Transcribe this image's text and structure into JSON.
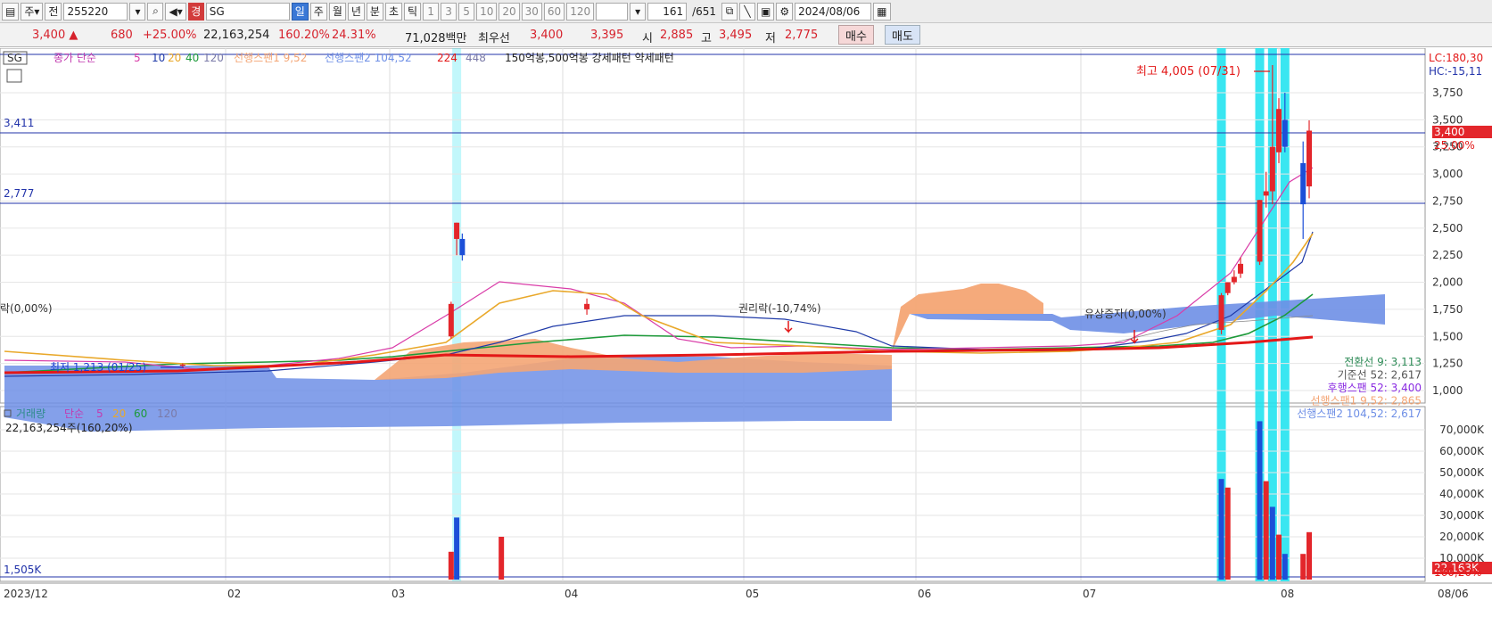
{
  "toolbar": {
    "market_prefix": "주",
    "prev_label": "전",
    "code": "255220",
    "badge": "경",
    "name": "SG",
    "periods": [
      "일",
      "주",
      "월",
      "년",
      "분",
      "초",
      "틱"
    ],
    "intervals": [
      "1",
      "3",
      "5",
      "10",
      "20",
      "30",
      "60",
      "120"
    ],
    "count": "161",
    "total": "/651",
    "date": "2024/08/06"
  },
  "quote": {
    "price": "3,400 ▲",
    "change": "680",
    "change_pct": "+25.00%",
    "volume": "22,163,254",
    "volume_pct": "160.20%",
    "turnover": "24.31%",
    "amount": "71,028백만",
    "bid_label": "최우선",
    "ask": "3,400",
    "bid": "3,395",
    "open_label": "시",
    "open": "2,885",
    "high_label": "고",
    "high": "3,495",
    "low_label": "저",
    "low": "2,775",
    "buy_label": "매수",
    "sell_label": "매도"
  },
  "colors": {
    "up": "#e3262b",
    "down": "#1c4fd8",
    "highlight": "#24e3f0",
    "cloud_pos": "#f4a574",
    "cloud_neg": "#6e8fe6",
    "ma5": "#d93ca8",
    "ma10": "#1f3aa8",
    "ma20": "#e9a82a",
    "ma40": "#1d9a3a",
    "ma120": "#e31818"
  },
  "price_legend": {
    "marker": "SG",
    "ma_title": "종가 단순",
    "ma_periods": [
      "5",
      "10",
      "20",
      "40",
      "120"
    ],
    "span1": "선행스팬1 9,52",
    "span2": "선행스팬2 104,52",
    "span_extra": [
      "224",
      "448"
    ],
    "pattern": "150억봉,500억봉 강세패턴 약세패턴"
  },
  "annotations": {
    "left_edge": "락(0,00%)",
    "low_marker": "최저 1,213 (01/25)",
    "rights": "권리락(-10,74%)",
    "paid_in": "유상증자(0,00%)",
    "high_marker": "최고 4,005 (07/31)",
    "level_upper": "3,411",
    "level_lower": "2,777",
    "lc": "LC:180,30",
    "hc": "HC:-15,11",
    "cur_price": "3,400",
    "cur_pct": "25,00%",
    "vol_tag": "22,163K",
    "vol_pct": "160,20%",
    "vol_level": "1,505K"
  },
  "ichimoku_legend": [
    {
      "text": "전환선 9: 3,113",
      "color": "#2e8b57"
    },
    {
      "text": "기준선 52: 2,617",
      "color": "#555555"
    },
    {
      "text": "후행스팬 52: 3,400",
      "color": "#8a2be2"
    },
    {
      "text": "선행스팬1 9,52: 2,865",
      "color": "#f4a574"
    },
    {
      "text": "선행스팬2 104,52: 2,617",
      "color": "#6e8fe6"
    }
  ],
  "volume_legend": {
    "title": "거래량",
    "ma_title": "단순",
    "periods": [
      "5",
      "20",
      "60",
      "120"
    ],
    "summary": "22,163,254주(160,20%)"
  },
  "chart_data": [
    {
      "type": "candlestick",
      "price_axis": {
        "range": [
          1000,
          4000
        ],
        "ticks": [
          "1,000",
          "1,250",
          "1,500",
          "1,750",
          "2,000",
          "2,250",
          "2,500",
          "2,750",
          "3,000",
          "3,250",
          "3,500",
          "3,750"
        ]
      },
      "x_axis_labels": [
        "2023/12",
        "02",
        "03",
        "04",
        "05",
        "06",
        "07",
        "08",
        "08/06"
      ],
      "candles": [
        {
          "d": "2024-01-25",
          "o": 1230,
          "h": 1250,
          "l": 1213,
          "c": 1240
        },
        {
          "d": "2024-03-12",
          "o": 1500,
          "h": 1820,
          "l": 1480,
          "c": 1800
        },
        {
          "d": "2024-03-13",
          "o": 2400,
          "h": 2550,
          "l": 2250,
          "c": 2550
        },
        {
          "d": "2024-03-14",
          "o": 2400,
          "h": 2450,
          "l": 2200,
          "c": 2250
        },
        {
          "d": "2024-04-05",
          "o": 1750,
          "h": 1850,
          "l": 1700,
          "c": 1800
        },
        {
          "d": "2024-07-23",
          "o": 1560,
          "h": 1900,
          "l": 1520,
          "c": 1880
        },
        {
          "d": "2024-07-24",
          "o": 1900,
          "h": 2000,
          "l": 1880,
          "c": 2000
        },
        {
          "d": "2024-07-25",
          "o": 2000,
          "h": 2110,
          "l": 1980,
          "c": 2050
        },
        {
          "d": "2024-07-26",
          "o": 2080,
          "h": 2230,
          "l": 2040,
          "c": 2170
        },
        {
          "d": "2024-07-29",
          "o": 2190,
          "h": 2760,
          "l": 2160,
          "c": 2760
        },
        {
          "d": "2024-07-30",
          "o": 2800,
          "h": 3020,
          "l": 2690,
          "c": 2840
        },
        {
          "d": "2024-07-31",
          "o": 2840,
          "h": 4005,
          "l": 2720,
          "c": 3250
        },
        {
          "d": "2024-08-01",
          "o": 3200,
          "h": 3700,
          "l": 3100,
          "c": 3600
        },
        {
          "d": "2024-08-02",
          "o": 3500,
          "h": 3750,
          "l": 3200,
          "c": 3250
        },
        {
          "d": "2024-08-05",
          "o": 3100,
          "h": 3300,
          "l": 2400,
          "c": 2720
        },
        {
          "d": "2024-08-06",
          "o": 2885,
          "h": 3495,
          "l": 2775,
          "c": 3400
        }
      ]
    },
    {
      "type": "bar",
      "name": "거래량",
      "y_axis": {
        "range": [
          0,
          80000
        ],
        "unit": "K",
        "ticks": [
          "10,000K",
          "20,000K",
          "30,000K",
          "40,000K",
          "50,000K",
          "60,000K",
          "70,000K"
        ]
      },
      "dates": [
        "2024-03-12",
        "2024-03-13",
        "2024-03-21",
        "2024-07-23",
        "2024-07-24",
        "2024-07-29",
        "2024-07-30",
        "2024-07-31",
        "2024-08-01",
        "2024-08-02",
        "2024-08-05",
        "2024-08-06"
      ],
      "values": [
        13000,
        29000,
        20000,
        47000,
        43000,
        74000,
        46000,
        34000,
        21000,
        12000,
        12000,
        22163
      ]
    }
  ]
}
